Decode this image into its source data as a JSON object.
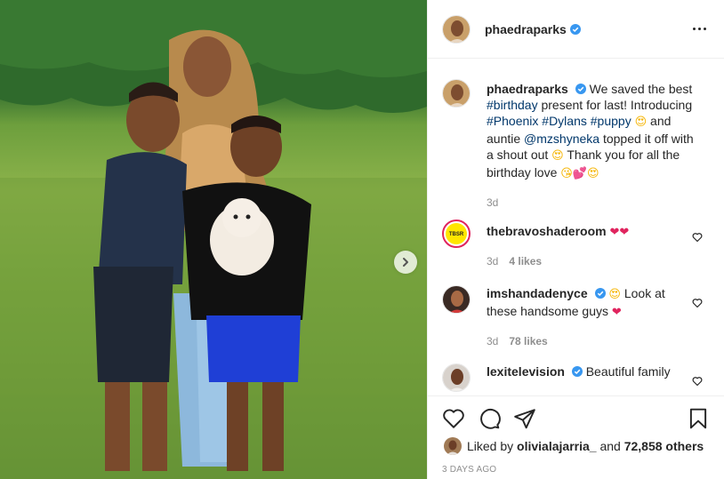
{
  "post": {
    "username": "phaedraparks",
    "verified": true,
    "caption": {
      "text_1": "We saved the best",
      "tag_birthday": "#birthday",
      "text_2": "present for last! Introducing",
      "tag_phoenix": "#Phoenix",
      "tag_dylans": "#Dylans",
      "tag_puppy": "#puppy",
      "text_3": "and auntie",
      "mention": "@mzshyneka",
      "text_4": "topped it off with a shout out",
      "text_5": "Thank you for all the birthday love",
      "time": "3d"
    },
    "liked_by_user": "olivialajarria_",
    "liked_by_prefix": "Liked by",
    "liked_by_and": "and",
    "likes_others": "72,858 others",
    "posted_ago": "3 DAYS AGO"
  },
  "comments": [
    {
      "username": "thebravoshaderoom",
      "verified": false,
      "text": "",
      "time": "3d",
      "likes": "4 likes"
    },
    {
      "username": "imshandadenyce",
      "verified": true,
      "text_1": "Look at",
      "text_2": "these handsome guys",
      "time": "3d",
      "likes": "78 likes"
    },
    {
      "username": "lexitelevision",
      "verified": true,
      "text": "Beautiful family"
    }
  ],
  "icons": {
    "verified": "verified-badge-icon",
    "more": "more-options-icon",
    "like": "heart-icon",
    "comment": "comment-bubble-icon",
    "share": "paper-plane-icon",
    "save": "bookmark-icon",
    "next": "chevron-right-icon"
  },
  "colors": {
    "verified_blue": "#3897f0",
    "link_blue": "#00376b",
    "meta_gray": "#8e8e8e",
    "text": "#262626",
    "heart_red": "#e0245e"
  }
}
